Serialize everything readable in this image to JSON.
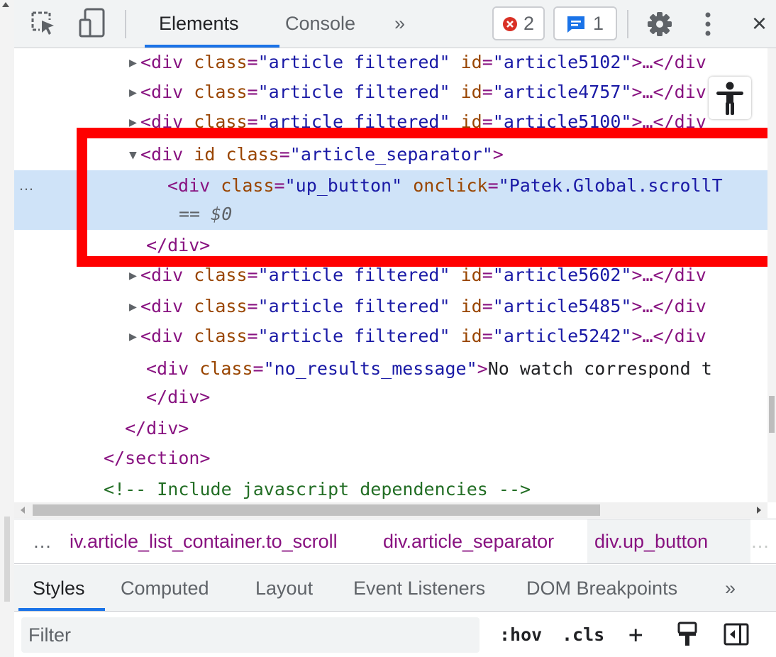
{
  "toolbar": {
    "inspect_icon": "inspect-element-icon",
    "device_icon": "device-toggle-icon",
    "tabs": [
      {
        "label": "Elements",
        "active": true
      },
      {
        "label": "Console",
        "active": false
      }
    ],
    "more_tabs": "»",
    "errors_count": "2",
    "messages_count": "1",
    "settings_icon": "gear-icon",
    "menu_icon": "more-vert-icon",
    "close": "×",
    "colors": {
      "error": "#d93025",
      "info": "#1a73e8",
      "accent": "#1a73e8"
    }
  },
  "tree": {
    "lines": [
      {
        "indent": 162,
        "triangle": "▶",
        "open": "<div ",
        "a1": "class",
        "v1": "\"article filtered\"",
        "a2": "id",
        "v2": "\"article5102\"",
        "rest": ">…</div"
      },
      {
        "indent": 162,
        "triangle": "▶",
        "open": "<div ",
        "a1": "class",
        "v1": "\"article filtered\"",
        "a2": "id",
        "v2": "\"article4757\"",
        "rest": ">…</div"
      },
      {
        "indent": 162,
        "triangle": "▶",
        "open": "<div ",
        "a1": "class",
        "v1": "\"article filtered\"",
        "a2": "id",
        "v2": "\"article5100\"",
        "rest": ">…</div"
      },
      {
        "indent": 162,
        "triangle": "▼",
        "open": "<div ",
        "a1": "id",
        "a1b": "class",
        "v1": "\"article_separator\"",
        "rest": ">"
      },
      {
        "indent": 216,
        "open": "<div ",
        "a1": "class",
        "v1": "\"up_button\"",
        "a2": "onclick",
        "v2": "\"Patek.Global.scrollT",
        "selected": true
      },
      {
        "indent": 232,
        "eq": "== ",
        "dollar": "$0"
      },
      {
        "indent": 186,
        "close": "</div>"
      },
      {
        "indent": 162,
        "triangle": "▶",
        "open": "<div ",
        "a1": "class",
        "v1": "\"article filtered\"",
        "a2": "id",
        "v2": "\"article5602\"",
        "rest": ">…</div"
      },
      {
        "indent": 162,
        "triangle": "▶",
        "open": "<div ",
        "a1": "class",
        "v1": "\"article filtered\"",
        "a2": "id",
        "v2": "\"article5485\"",
        "rest": ">…</div"
      },
      {
        "indent": 162,
        "triangle": "▶",
        "open": "<div ",
        "a1": "class",
        "v1": "\"article filtered\"",
        "a2": "id",
        "v2": "\"article5242\"",
        "rest": ">…</div"
      },
      {
        "indent": 186,
        "open": "<div ",
        "a1": "class",
        "v1": "\"no_results_message\"",
        "rest": ">",
        "text": "No watch correspond t"
      },
      {
        "indent": 186,
        "close": "</div>"
      },
      {
        "indent": 156,
        "close": "</div>"
      },
      {
        "indent": 126,
        "close": "</section>"
      },
      {
        "indent": 126,
        "comment": "<!-- Include javascript dependencies -->"
      }
    ],
    "selected_dots": "…",
    "a11y_icon": "accessibility-icon"
  },
  "breadcrumbs": {
    "leading": "…",
    "items": [
      "iv.article_list_container.to_scroll",
      "div.article_separator",
      "div.up_button"
    ],
    "trailing": "…"
  },
  "styles_tabs": {
    "tabs": [
      "Styles",
      "Computed",
      "Layout",
      "Event Listeners",
      "DOM Breakpoints"
    ],
    "more": "»"
  },
  "filter": {
    "placeholder": "Filter",
    "hov": ":hov",
    "cls": ".cls",
    "plus": "+",
    "paint_icon": "paint-brush-icon",
    "sidebar_icon": "toggle-sidebar-icon"
  }
}
